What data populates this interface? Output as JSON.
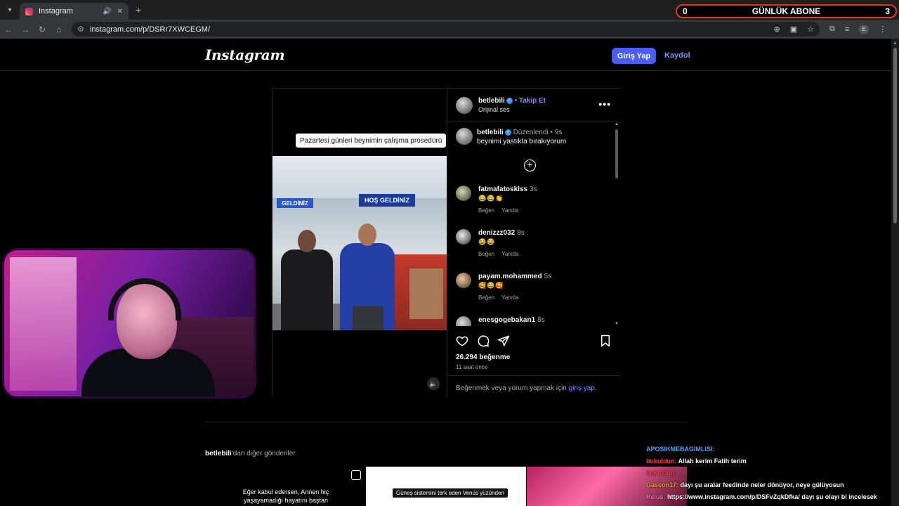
{
  "browser": {
    "tab_title": "Instagram",
    "url": "instagram.com/p/DSRr7XWCEGM/",
    "new_tab": "+",
    "close": "✕"
  },
  "sub_overlay": {
    "left_value": "0",
    "label": "GÜNLÜK ABONE",
    "right_value": "3"
  },
  "header": {
    "logo": "Instagram",
    "login_label": "Giriş Yap",
    "signup_label": "Kaydol"
  },
  "post": {
    "video_caption": "Pazartesi günleri beynimin çalışma prosedürü",
    "sign_main": "HOŞ GELDİNİZ",
    "sign_side": "GELDİNİZ",
    "author": "betlebili",
    "follow_label": "• Takip Et",
    "audio": "Orijinal ses",
    "caption_author": "betlebili",
    "edited_label": "Düzenlendi •",
    "caption_time": "9s",
    "caption_text": "beynimi yastıkta bırakıyorum",
    "comments": [
      {
        "user": "fatmafatosklss",
        "time": "3s",
        "emoji": "😂😂👏",
        "like": "Beğen",
        "reply": "Yanıtla"
      },
      {
        "user": "denizzz032",
        "time": "8s",
        "emoji": "😂😂",
        "like": "Beğen",
        "reply": "Yanıtla"
      },
      {
        "user": "payam.mohammed",
        "time": "5s",
        "emoji": "🥰😂🥰",
        "like": "Beğen",
        "reply": "Yanıtla"
      },
      {
        "user": "enesgogebakan1",
        "time": "8s",
        "emoji": "",
        "like": "",
        "reply": ""
      }
    ],
    "likes": "26.294 beğenme",
    "time_ago": "11 saat önce",
    "login_prompt_prefix": "Beğenmek veya yorum yapmak için",
    "login_prompt_link": "giriş yap",
    "login_prompt_suffix": "."
  },
  "more_posts": {
    "author": "betlebili",
    "suffix": "'dan diğer gönderiler",
    "thumb1_text": "Eğer kabul edersen, Annen hiç yaşayamadığı hayatını baştan",
    "thumb2_text": "Güneş sistemini terk eden Venüs yüzünden"
  },
  "chat": [
    {
      "name": "APOSIKMEBAGIMLISI:",
      "msg": ""
    },
    {
      "name": "bukuldun:",
      "msg": "Allah kerim Fatih terim"
    },
    {
      "name": "bukuldun:",
      "msg": ""
    },
    {
      "name": "Gascon17:",
      "msg": "dayı şu aralar feedinde neler dönüyor, neye gülüyosun"
    },
    {
      "name": "Reius:",
      "msg": "https://www.instagram.com/p/DSFvZqkDfka/ dayı şu olayı bi incelesek"
    }
  ],
  "colors": {
    "accent": "#4a5df9",
    "link": "#7f8cfb",
    "verified": "#3797f0",
    "overlay_border": "#e8391b"
  }
}
